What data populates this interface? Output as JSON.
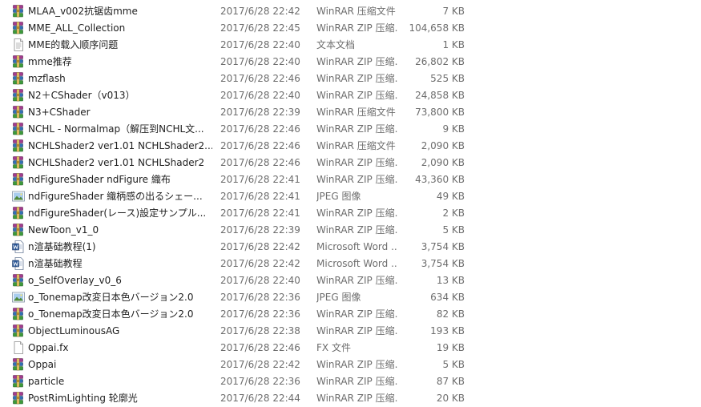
{
  "files": [
    {
      "name": "MLAA_v002抗锯齿mme",
      "date": "2017/6/28 22:42",
      "type": "WinRAR 压缩文件",
      "size": "7 KB",
      "icon": "winrar-archive-icon"
    },
    {
      "name": "MME_ALL_Collection",
      "date": "2017/6/28 22:45",
      "type": "WinRAR ZIP 压缩...",
      "size": "104,658 KB",
      "icon": "winrar-archive-icon"
    },
    {
      "name": "MME的载入顺序问题",
      "date": "2017/6/28 22:40",
      "type": "文本文档",
      "size": "1 KB",
      "icon": "text-document-icon"
    },
    {
      "name": "mme推荐",
      "date": "2017/6/28 22:40",
      "type": "WinRAR ZIP 压缩...",
      "size": "26,802 KB",
      "icon": "winrar-archive-icon"
    },
    {
      "name": "mzflash",
      "date": "2017/6/28 22:46",
      "type": "WinRAR ZIP 压缩...",
      "size": "525 KB",
      "icon": "winrar-archive-icon"
    },
    {
      "name": "N2＋CShader（v013）",
      "date": "2017/6/28 22:40",
      "type": "WinRAR ZIP 压缩...",
      "size": "24,858 KB",
      "icon": "winrar-archive-icon"
    },
    {
      "name": "N3+CShader",
      "date": "2017/6/28 22:39",
      "type": "WinRAR 压缩文件",
      "size": "73,800 KB",
      "icon": "winrar-archive-icon"
    },
    {
      "name": "NCHL - Normalmap（解压到NCHL文...",
      "date": "2017/6/28 22:46",
      "type": "WinRAR ZIP 压缩...",
      "size": "9 KB",
      "icon": "winrar-archive-icon"
    },
    {
      "name": "NCHLShader2 ver1.01 NCHLShader2...",
      "date": "2017/6/28 22:46",
      "type": "WinRAR 压缩文件",
      "size": "2,090 KB",
      "icon": "winrar-archive-icon"
    },
    {
      "name": "NCHLShader2 ver1.01 NCHLShader2",
      "date": "2017/6/28 22:46",
      "type": "WinRAR ZIP 压缩...",
      "size": "2,090 KB",
      "icon": "winrar-archive-icon"
    },
    {
      "name": "ndFigureShader ndFigure 織布",
      "date": "2017/6/28 22:41",
      "type": "WinRAR ZIP 压缩...",
      "size": "43,360 KB",
      "icon": "winrar-archive-icon"
    },
    {
      "name": "ndFigureShader 織柄感の出るシェー...",
      "date": "2017/6/28 22:41",
      "type": "JPEG 图像",
      "size": "49 KB",
      "icon": "jpeg-image-icon"
    },
    {
      "name": "ndFigureShader(レース)設定サンプル...",
      "date": "2017/6/28 22:41",
      "type": "WinRAR ZIP 压缩...",
      "size": "2 KB",
      "icon": "winrar-archive-icon"
    },
    {
      "name": "NewToon_v1_0",
      "date": "2017/6/28 22:39",
      "type": "WinRAR ZIP 压缩...",
      "size": "5 KB",
      "icon": "winrar-archive-icon"
    },
    {
      "name": "n渲基础教程(1)",
      "date": "2017/6/28 22:42",
      "type": "Microsoft Word ...",
      "size": "3,754 KB",
      "icon": "word-document-icon"
    },
    {
      "name": "n渲基础教程",
      "date": "2017/6/28 22:42",
      "type": "Microsoft Word ...",
      "size": "3,754 KB",
      "icon": "word-document-icon"
    },
    {
      "name": "o_SelfOverlay_v0_6",
      "date": "2017/6/28 22:40",
      "type": "WinRAR ZIP 压缩...",
      "size": "13 KB",
      "icon": "winrar-archive-icon"
    },
    {
      "name": "o_Tonemap改変日本色バージョン2.0",
      "date": "2017/6/28 22:36",
      "type": "JPEG 图像",
      "size": "634 KB",
      "icon": "jpeg-image-icon"
    },
    {
      "name": "o_Tonemap改変日本色バージョン2.0",
      "date": "2017/6/28 22:36",
      "type": "WinRAR ZIP 压缩...",
      "size": "82 KB",
      "icon": "winrar-archive-icon"
    },
    {
      "name": "ObjectLuminousAG",
      "date": "2017/6/28 22:38",
      "type": "WinRAR ZIP 压缩...",
      "size": "193 KB",
      "icon": "winrar-archive-icon"
    },
    {
      "name": "Oppai.fx",
      "date": "2017/6/28 22:46",
      "type": "FX 文件",
      "size": "19 KB",
      "icon": "blank-file-icon"
    },
    {
      "name": "Oppai",
      "date": "2017/6/28 22:42",
      "type": "WinRAR ZIP 压缩...",
      "size": "5 KB",
      "icon": "winrar-archive-icon"
    },
    {
      "name": "particle",
      "date": "2017/6/28 22:36",
      "type": "WinRAR ZIP 压缩...",
      "size": "87 KB",
      "icon": "winrar-archive-icon"
    },
    {
      "name": "PostRimLighting 轮廓光",
      "date": "2017/6/28 22:44",
      "type": "WinRAR ZIP 压缩...",
      "size": "20 KB",
      "icon": "winrar-archive-icon"
    }
  ]
}
